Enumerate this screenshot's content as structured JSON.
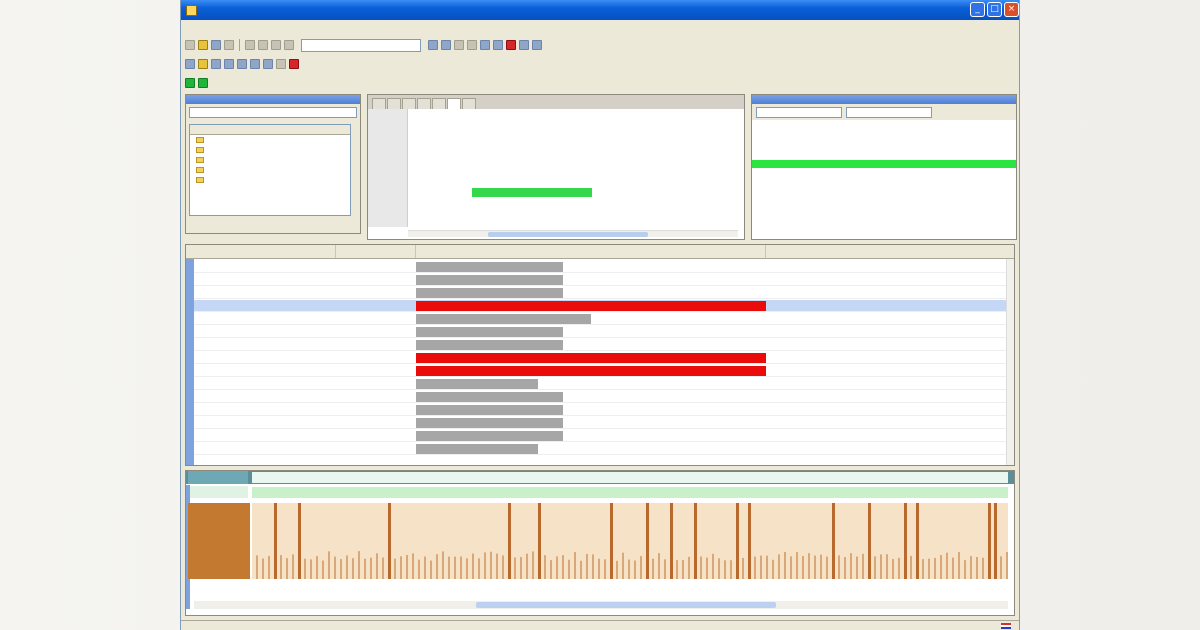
{
  "window": {
    "title": "",
    "buttons": [
      "_",
      "□",
      "×"
    ]
  },
  "menu": [],
  "toolbar": {
    "row1_icons": [
      "new-icon",
      "open-icon",
      "save-icon",
      "run-icon",
      "stop-icon",
      "find-icon",
      "undo-icon",
      "redo-icon"
    ],
    "row2_icons": [
      "step-icon",
      "watch-icon",
      "break-icon",
      "trace-icon"
    ],
    "row3_icons": [
      "play-icon",
      "record-icon"
    ]
  },
  "left_panel": {
    "title": "",
    "search_value": "",
    "tree_headers": [
      "",
      "",
      ""
    ],
    "tree_items": [
      "",
      "",
      "",
      "",
      ""
    ],
    "footer": ""
  },
  "code": {
    "tabs": [
      "",
      "",
      "",
      "",
      "",
      "",
      ""
    ],
    "highlight": "",
    "lines": [
      "",
      "",
      "",
      "",
      "",
      "",
      "",
      "",
      ""
    ]
  },
  "right_panel": {
    "title": "",
    "rows": 12,
    "highlight_row": 5
  },
  "grid": {
    "headers": [
      "",
      "",
      ""
    ],
    "rows": [
      {
        "time": "",
        "addr": "",
        "bar": 0.42,
        "color": "grey"
      },
      {
        "time": "",
        "addr": "",
        "bar": 0.42,
        "color": "grey"
      },
      {
        "time": "",
        "addr": "",
        "bar": 0.42,
        "color": "grey"
      },
      {
        "time": "",
        "addr": "",
        "bar": 1.0,
        "color": "red",
        "selected": true
      },
      {
        "time": "",
        "addr": "",
        "bar": 0.5,
        "color": "grey"
      },
      {
        "time": "",
        "addr": "",
        "bar": 0.42,
        "color": "grey"
      },
      {
        "time": "",
        "addr": "",
        "bar": 0.42,
        "color": "grey"
      },
      {
        "time": "",
        "addr": "",
        "bar": 1.0,
        "color": "red"
      },
      {
        "time": "",
        "addr": "",
        "bar": 1.0,
        "color": "red"
      },
      {
        "time": "",
        "addr": "",
        "bar": 0.35,
        "color": "grey"
      },
      {
        "time": "",
        "addr": "",
        "bar": 0.42,
        "color": "grey"
      },
      {
        "time": "",
        "addr": "",
        "bar": 0.42,
        "color": "grey"
      },
      {
        "time": "",
        "addr": "",
        "bar": 0.42,
        "color": "grey"
      },
      {
        "time": "",
        "addr": "",
        "bar": 0.42,
        "color": "grey"
      },
      {
        "time": "",
        "addr": "",
        "bar": 0.35,
        "color": "grey"
      }
    ]
  },
  "timeline": {
    "row1_label": "",
    "row2_label": "",
    "activity_label": "",
    "axis_ticks": [
      "",
      "",
      "",
      "",
      "",
      "",
      "",
      "",
      "",
      "",
      ""
    ]
  },
  "status": {
    "text": ""
  },
  "colors": {
    "titlebar": "#0a5fd8",
    "highlight_red": "#ea0b0b",
    "highlight_green": "#2ae43f",
    "activity": "#c3792f"
  }
}
